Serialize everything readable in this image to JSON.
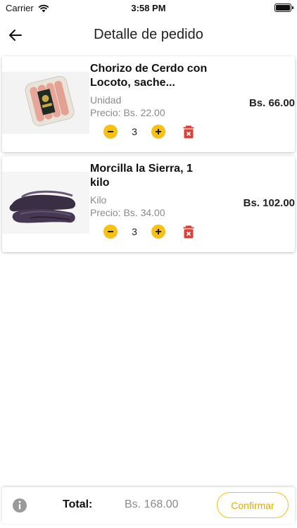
{
  "status_bar": {
    "carrier": "Carrier",
    "time": "3:58 PM"
  },
  "nav": {
    "title": "Detalle de pedido"
  },
  "items": [
    {
      "name": "Chorizo de Cerdo con Locoto, sache...",
      "unit": "Unidad",
      "price": "Precio: Bs. 22.00",
      "quantity": "3",
      "subtotal": "Bs. 66.00",
      "image": "chorizo-package-photo"
    },
    {
      "name": "Morcilla la Sierra, 1 kilo",
      "unit": "Kilo",
      "price": "Precio: Bs. 34.00",
      "quantity": "3",
      "subtotal": "Bs. 102.00",
      "image": "morcilla-photo"
    }
  ],
  "footer": {
    "total_label": "Total:",
    "total_value": "Bs. 168.00",
    "confirm_label": "Confirmar"
  },
  "colors": {
    "accent": "#f5c01a",
    "delete": "#d9423a",
    "muted": "#8a8a8a"
  }
}
